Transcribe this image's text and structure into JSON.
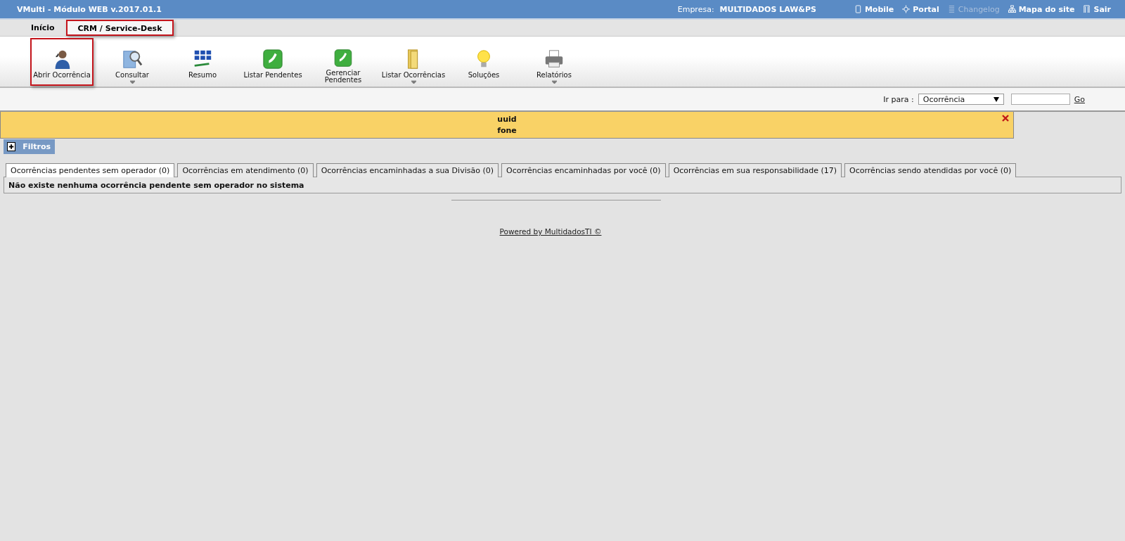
{
  "header": {
    "title": "VMulti - Módulo WEB v.2017.01.1",
    "company_label": "Empresa:",
    "company": "MULTIDADOS LAW&PS",
    "links": [
      {
        "label": "Mobile",
        "kind": "phone",
        "disabled": false
      },
      {
        "label": "Portal",
        "kind": "move",
        "disabled": false
      },
      {
        "label": "Changelog",
        "kind": "lines",
        "disabled": true
      },
      {
        "label": "Mapa do site",
        "kind": "sitemap",
        "disabled": false
      },
      {
        "label": "Sair",
        "kind": "door",
        "disabled": false
      }
    ]
  },
  "module_tabs": [
    {
      "label": "Início",
      "selected": false,
      "highlighted": false
    },
    {
      "label": "CRM / Service-Desk",
      "selected": true,
      "highlighted": true
    }
  ],
  "toolbar": [
    {
      "label": "Abrir Ocorrência",
      "kind": "person",
      "has_menu": false,
      "highlighted": true
    },
    {
      "label": "Consultar",
      "kind": "search",
      "has_menu": true,
      "highlighted": false
    },
    {
      "label": "Resumo",
      "kind": "grid",
      "has_menu": false,
      "highlighted": false
    },
    {
      "label": "Listar Pendentes",
      "kind": "phone",
      "has_menu": false,
      "highlighted": false
    },
    {
      "label": "Gerenciar Pendentes",
      "kind": "phone",
      "has_menu": false,
      "highlighted": false
    },
    {
      "label": "Listar Ocorrências",
      "kind": "folder",
      "has_menu": true,
      "highlighted": false
    },
    {
      "label": "Soluções",
      "kind": "bulb",
      "has_menu": false,
      "highlighted": false
    },
    {
      "label": "Relatórios",
      "kind": "printer",
      "has_menu": true,
      "highlighted": false
    }
  ],
  "goto": {
    "label": "Ir para :",
    "select_value": "Ocorrência",
    "button": "Go"
  },
  "alert": {
    "lines": [
      "uuid",
      "fone"
    ]
  },
  "filters": {
    "label": "Filtros",
    "expanded": false
  },
  "tabs": [
    {
      "label": "Ocorrências pendentes sem operador (0)",
      "selected": true
    },
    {
      "label": "Ocorrências em atendimento (0)",
      "selected": false
    },
    {
      "label": "Ocorrências encaminhadas a sua Divisão (0)",
      "selected": false
    },
    {
      "label": "Ocorrências encaminhadas por você (0)",
      "selected": false
    },
    {
      "label": "Ocorrências em sua responsabilidade (17)",
      "selected": false
    },
    {
      "label": "Ocorrências sendo atendidas por você (0)",
      "selected": false
    }
  ],
  "message": "Não existe nenhuma ocorrência pendente sem operador no sistema",
  "footer": "Powered by MultidadosTI ©"
}
